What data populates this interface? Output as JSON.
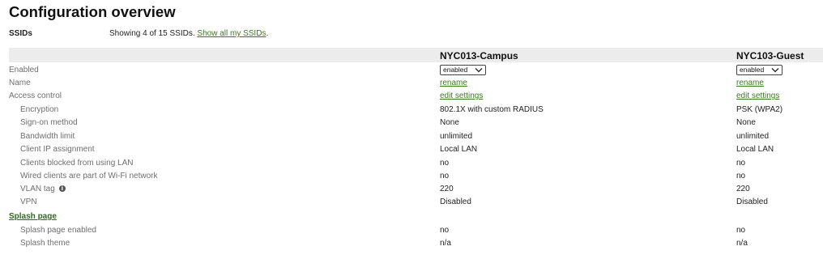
{
  "page": {
    "title": "Configuration overview",
    "ssids_label": "SSIDs",
    "showing_text": "Showing 4 of 15 SSIDs.",
    "show_all_link": "Show all my SSIDs"
  },
  "columns": [
    {
      "name": "NYC013-Campus"
    },
    {
      "name": "NYC103-Guest"
    }
  ],
  "rows": {
    "enabled": {
      "label": "Enabled",
      "values": [
        "enabled",
        "enabled"
      ]
    },
    "name": {
      "label": "Name",
      "values": [
        "rename",
        "rename"
      ]
    },
    "access_control": {
      "label": "Access control",
      "values": [
        "edit settings",
        "edit settings"
      ]
    },
    "encryption": {
      "label": "Encryption",
      "values": [
        "802.1X with custom RADIUS",
        "PSK (WPA2)"
      ]
    },
    "sign_on": {
      "label": "Sign-on method",
      "values": [
        "None",
        "None"
      ]
    },
    "bandwidth": {
      "label": "Bandwidth limit",
      "values": [
        "unlimited",
        "unlimited"
      ]
    },
    "client_ip": {
      "label": "Client IP assignment",
      "values": [
        "Local LAN",
        "Local LAN"
      ]
    },
    "blocked_lan": {
      "label": "Clients blocked from using LAN",
      "values": [
        "no",
        "no"
      ]
    },
    "wired_clients": {
      "label": "Wired clients are part of Wi-Fi network",
      "values": [
        "no",
        "no"
      ]
    },
    "vlan": {
      "label": "VLAN tag",
      "values": [
        "220",
        "220"
      ]
    },
    "vpn": {
      "label": "VPN",
      "values": [
        "Disabled",
        "Disabled"
      ]
    },
    "splash_section": {
      "label": "Splash page"
    },
    "splash_enabled": {
      "label": "Splash page enabled",
      "values": [
        "no",
        "no"
      ]
    },
    "splash_theme": {
      "label": "Splash theme",
      "values": [
        "n/a",
        "n/a"
      ]
    }
  },
  "icons": {
    "vlan_info": "info-icon",
    "select_chevron": "chevron-down-icon"
  },
  "colors": {
    "link": "#3b7a1a",
    "header_band": "#ececec"
  }
}
